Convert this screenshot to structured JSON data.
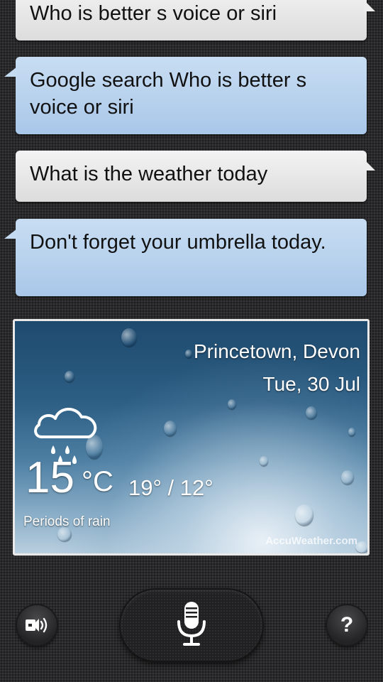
{
  "conversation": [
    {
      "role": "user",
      "text": "Who is better s voice or siri"
    },
    {
      "role": "assistant",
      "text": "Google search Who is better s voice or siri"
    },
    {
      "role": "user",
      "text": "What is the weather today"
    },
    {
      "role": "assistant",
      "text": "Don't forget your umbrella today."
    }
  ],
  "weather": {
    "location": "Princetown, Devon",
    "date": "Tue, 30 Jul",
    "icon": "rain-cloud-icon",
    "temperature": "15",
    "unit": "°C",
    "high_low": "19° / 12°",
    "condition": "Periods of rain",
    "provider": "AccuWeather.com"
  },
  "controls": {
    "speaker_icon": "speaker-output-icon",
    "mic_icon": "microphone-icon",
    "help_label": "?"
  },
  "colors": {
    "user_bubble": "#e6e6e6",
    "assistant_bubble": "#b8d2ee",
    "background": "#2b2b2d"
  }
}
